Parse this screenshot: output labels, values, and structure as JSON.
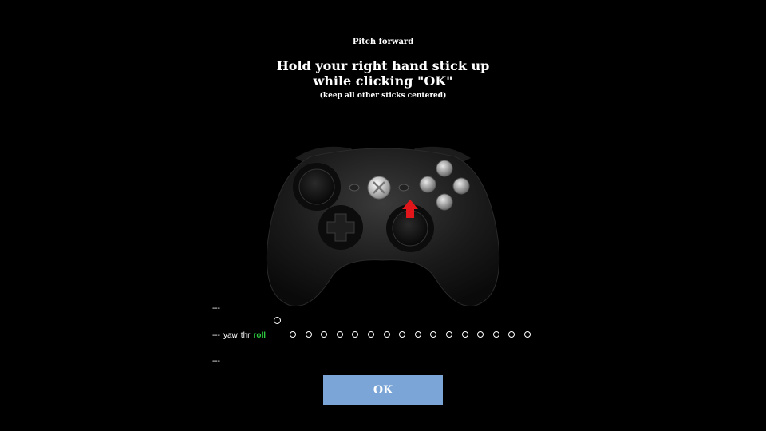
{
  "step_title": "Pitch forward",
  "instruction": {
    "line1": "Hold your right hand stick up",
    "line2": "while clicking \"OK\""
  },
  "note": "(keep all other sticks centered)",
  "controller": {
    "icon": "game-controller-icon",
    "highlight": "right-stick-up-arrow",
    "arrow_color": "#e0161a"
  },
  "axes": {
    "top_marker": "---",
    "bottom_marker": "---",
    "main_prefix": "---",
    "labels": [
      "yaw",
      "thr"
    ],
    "active_label": "roll",
    "active_color": "#2ecc40",
    "dot_count": 16
  },
  "ok_button": {
    "label": "OK",
    "color": "#7aa5d6"
  }
}
